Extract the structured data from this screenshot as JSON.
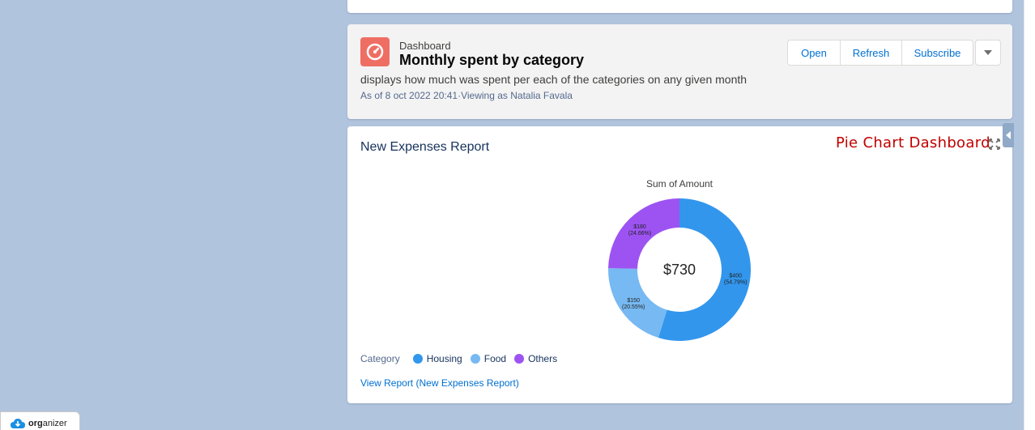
{
  "header": {
    "eyebrow": "Dashboard",
    "title": "Monthly spent by category",
    "description": "displays how much was spent per each of the categories on any given month",
    "as_of": "As of 8 oct 2022 20:41·Viewing as Natalia Favala",
    "buttons": {
      "open": "Open",
      "refresh": "Refresh",
      "subscribe": "Subscribe"
    }
  },
  "report": {
    "title": "New Expenses Report",
    "annotation": "Pie Chart Dashboard",
    "view_report_link": "View Report (New Expenses Report)"
  },
  "chart_data": {
    "type": "donut",
    "title": "Sum of Amount",
    "center_label": "$730",
    "legend_title": "Category",
    "categories": [
      "Housing",
      "Food",
      "Others"
    ],
    "values": [
      400,
      150,
      180
    ],
    "value_labels": [
      "$400",
      "$150",
      "$180"
    ],
    "percent_labels": [
      "(54.79%)",
      "(20.55%)",
      "(24.66%)"
    ],
    "colors": [
      "#3296ed",
      "#77b9f2",
      "#9d53f2"
    ],
    "legend_placement": "bottom-left"
  },
  "organizer": {
    "label_bold": "org",
    "label_rest": "anizer"
  }
}
